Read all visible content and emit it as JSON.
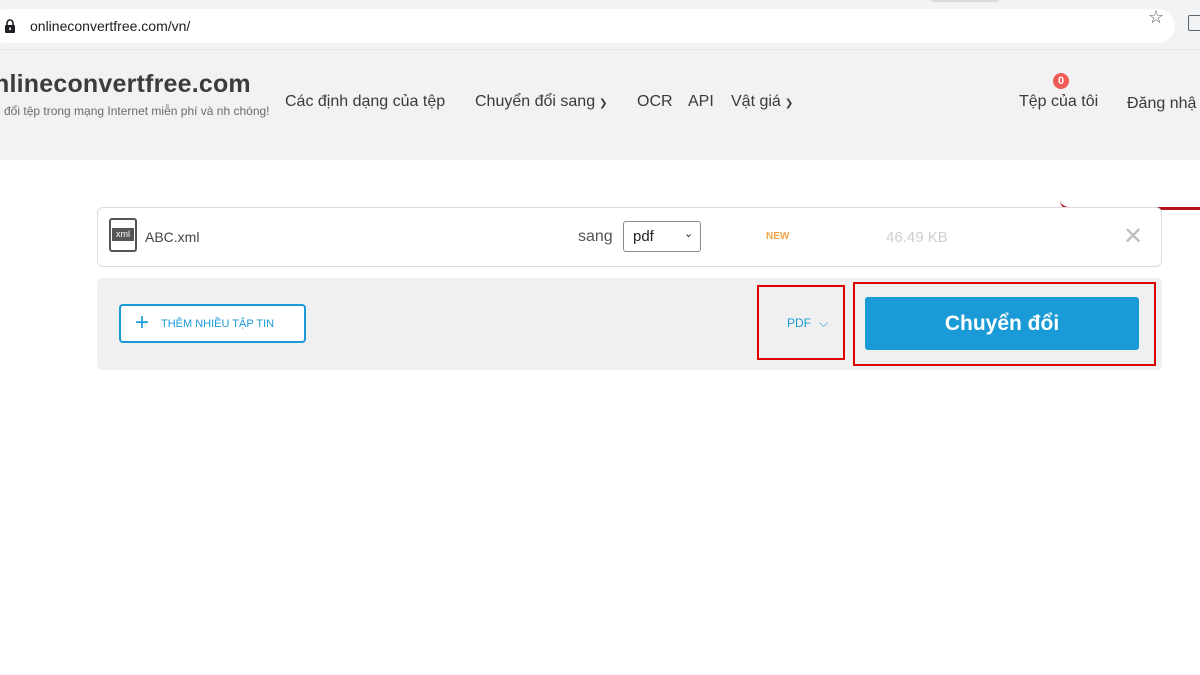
{
  "browser": {
    "url": "onlineconvertfree.com/vn/",
    "lock_icon": "lock-icon",
    "star_icon": "star-icon"
  },
  "header": {
    "brand": "nlineconvertfree.com",
    "tagline": "n đổi tệp trong mạng Internet miễn phí và nh chóng!",
    "nav": [
      {
        "label": "Các định dạng của tệp",
        "dropdown": false
      },
      {
        "label": "Chuyển đổi sang",
        "dropdown": true
      },
      {
        "label": "OCR",
        "dropdown": false
      },
      {
        "label": "API",
        "dropdown": false
      },
      {
        "label": "Vật giá",
        "dropdown": true
      }
    ],
    "files_count": "0",
    "my_files": "Tệp của tôi",
    "login": "Đăng nhậ"
  },
  "file_row": {
    "icon_label": "xml",
    "name": "ABC.xml",
    "to_label": "sang",
    "format": "pdf",
    "new_badge": "NEW",
    "size": "46.49 KB"
  },
  "actions": {
    "add_files": "THÊM NHIỀU TẬP TIN",
    "format_all": "PDF",
    "convert": "Chuyển đổi"
  },
  "colors": {
    "accent": "#1a9ad6",
    "highlight": "#e00000",
    "new_badge": "#f0a24a"
  }
}
